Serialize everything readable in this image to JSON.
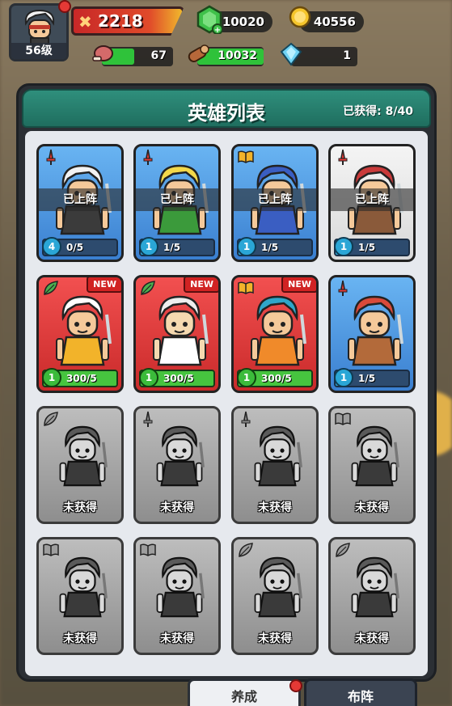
{
  "player": {
    "level": "56级",
    "power": "2218"
  },
  "resources": {
    "gems": "10020",
    "coins": "40556"
  },
  "meters": [
    {
      "name": "meat",
      "value": "67",
      "fill": 0.45,
      "color": "#2fc23a"
    },
    {
      "name": "wood",
      "value": "10032",
      "fill": 1.0,
      "color": "#2fc23a"
    },
    {
      "name": "crystal",
      "value": "1",
      "fill": 0.0,
      "color": "#2fc23a"
    }
  ],
  "panel": {
    "title": "英雄列表",
    "count": "已获得: 8/40"
  },
  "status": {
    "deployed": "已上阵",
    "locked": "未获得"
  },
  "heroes": [
    {
      "color": "blue",
      "tag": "red",
      "deployed": true,
      "level": "4",
      "progress": "0/5",
      "fill": 0.0,
      "new": false,
      "hair": "#f2f2f2",
      "skin": "#f5c99a",
      "outfit": "#3b3b3b"
    },
    {
      "color": "blue",
      "tag": "red",
      "deployed": true,
      "level": "1",
      "progress": "1/5",
      "fill": 0.2,
      "new": false,
      "hair": "#f3d84a",
      "skin": "#f5c99a",
      "outfit": "#3b9a3b"
    },
    {
      "color": "blue",
      "tag": "book",
      "deployed": true,
      "level": "1",
      "progress": "1/5",
      "fill": 0.2,
      "new": false,
      "hair": "#3a5ec2",
      "skin": "#f5c99a",
      "outfit": "#3a5ec2"
    },
    {
      "color": "white",
      "tag": "red",
      "deployed": true,
      "level": "1",
      "progress": "1/5",
      "fill": 0.2,
      "new": false,
      "hair": "#c93a3a",
      "skin": "#f5c99a",
      "outfit": "#8a5a3a"
    },
    {
      "color": "red",
      "tag": "green",
      "deployed": false,
      "level": "1",
      "progress": "300/5",
      "fill": 1.0,
      "new": true,
      "hair": "#ffffff",
      "skin": "#f5c99a",
      "outfit": "#f2b32a"
    },
    {
      "color": "red",
      "tag": "green",
      "deployed": false,
      "level": "1",
      "progress": "300/5",
      "fill": 1.0,
      "new": true,
      "hair": "#eeeeee",
      "skin": "#f5d9b0",
      "outfit": "#ffffff"
    },
    {
      "color": "red",
      "tag": "book",
      "deployed": false,
      "level": "1",
      "progress": "300/5",
      "fill": 1.0,
      "new": true,
      "hair": "#2fa6c9",
      "skin": "#f5c99a",
      "outfit": "#f08a2a"
    },
    {
      "color": "blue",
      "tag": "red",
      "deployed": false,
      "level": "1",
      "progress": "1/5",
      "fill": 0.2,
      "new": false,
      "hair": "#d94a3a",
      "skin": "#f5c99a",
      "outfit": "#b36a3a"
    },
    {
      "color": "gray",
      "tag": "gray-leaf",
      "locked": true
    },
    {
      "color": "gray",
      "tag": "gray-sword",
      "locked": true
    },
    {
      "color": "gray",
      "tag": "gray-sword",
      "locked": true
    },
    {
      "color": "gray",
      "tag": "gray-book",
      "locked": true
    },
    {
      "color": "gray",
      "tag": "gray-book",
      "locked": true
    },
    {
      "color": "gray",
      "tag": "gray-book",
      "locked": true
    },
    {
      "color": "gray",
      "tag": "gray-leaf",
      "locked": true
    },
    {
      "color": "gray",
      "tag": "gray-leaf",
      "locked": true
    }
  ],
  "new_label": "NEW",
  "tabs": {
    "active": "养成",
    "inactive": "布阵"
  }
}
